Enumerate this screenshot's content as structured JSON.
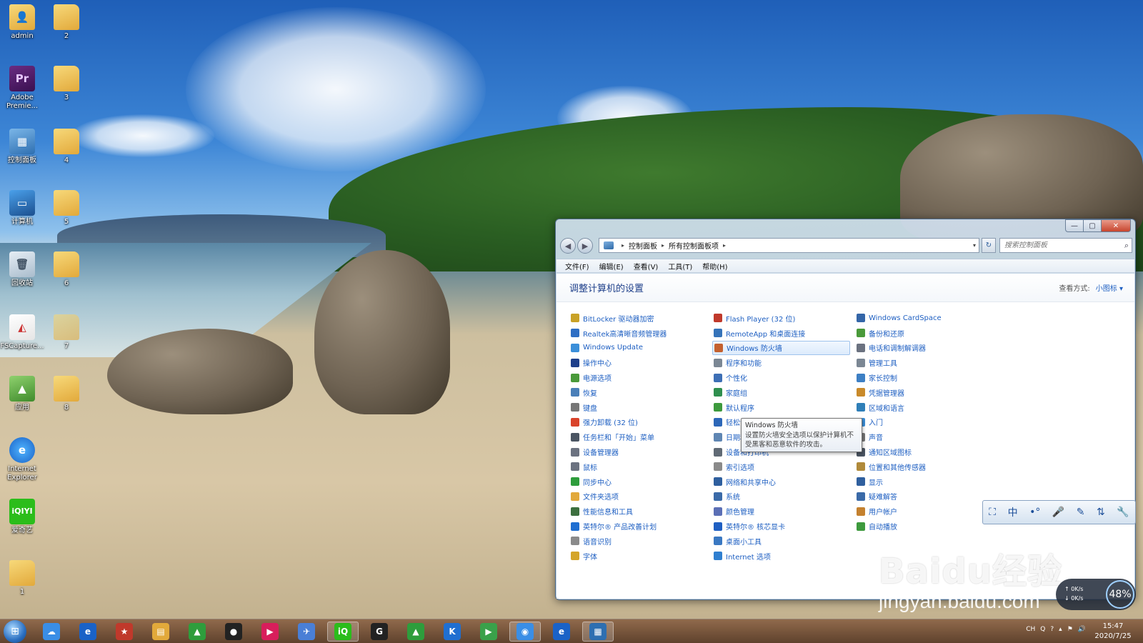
{
  "desktop": {
    "icons": [
      {
        "label": "admin",
        "glyph": "👤"
      },
      {
        "label": "2",
        "glyph": ""
      },
      {
        "label": "Adobe Premie...",
        "glyph": "Pr"
      },
      {
        "label": "3",
        "glyph": ""
      },
      {
        "label": "控制面板",
        "glyph": "▦"
      },
      {
        "label": "4",
        "glyph": ""
      },
      {
        "label": "计算机",
        "glyph": "▭"
      },
      {
        "label": "5",
        "glyph": ""
      },
      {
        "label": "回收站",
        "glyph": "🗑"
      },
      {
        "label": "6",
        "glyph": ""
      },
      {
        "label": "FSCapture...",
        "glyph": "◭"
      },
      {
        "label": "7",
        "glyph": ""
      },
      {
        "label": "应用",
        "glyph": "▲"
      },
      {
        "label": "8",
        "glyph": ""
      },
      {
        "label": "Internet Explorer",
        "glyph": "e"
      },
      {
        "label": "爱奇艺",
        "glyph": "iQIYI"
      },
      {
        "label": "1",
        "glyph": ""
      }
    ]
  },
  "window": {
    "controls": {
      "minimize": "—",
      "maximize": "▢",
      "close": "✕"
    },
    "nav": {
      "back": "◀",
      "forward": "▶"
    },
    "address": {
      "crumbs": [
        "控制面板",
        "所有控制面板项"
      ],
      "separator": "▸",
      "dropdown": "▾"
    },
    "refresh": "↻",
    "search": {
      "placeholder": "搜索控制面板",
      "icon": "⌕"
    },
    "menu": [
      "文件(F)",
      "编辑(E)",
      "查看(V)",
      "工具(T)",
      "帮助(H)"
    ],
    "title": "调整计算机的设置",
    "view_by_label": "查看方式:",
    "view_by_value": "小图标 ▾",
    "items": [
      {
        "label": "BitLocker 驱动器加密",
        "color": "#c9a227"
      },
      {
        "label": "Realtek高清晰音频管理器",
        "color": "#2f6fc4"
      },
      {
        "label": "Windows Update",
        "color": "#3b8fd9"
      },
      {
        "label": "操作中心",
        "color": "#1e3f8a"
      },
      {
        "label": "电源选项",
        "color": "#4a9a3a"
      },
      {
        "label": "恢复",
        "color": "#4a7fb8"
      },
      {
        "label": "键盘",
        "color": "#777777"
      },
      {
        "label": "强力卸载 (32 位)",
        "color": "#d9432a"
      },
      {
        "label": "任务栏和「开始」菜单",
        "color": "#4b5563"
      },
      {
        "label": "设备管理器",
        "color": "#6b7280"
      },
      {
        "label": "鼠标",
        "color": "#6b7280"
      },
      {
        "label": "同步中心",
        "color": "#2e9d3c"
      },
      {
        "label": "文件夹选项",
        "color": "#e2a93b"
      },
      {
        "label": "性能信息和工具",
        "color": "#3c6f3f"
      },
      {
        "label": "英特尔® 产品改善计划",
        "color": "#1f6fd1"
      },
      {
        "label": "语音识别",
        "color": "#8a8a8a"
      },
      {
        "label": "字体",
        "color": "#d4a52a"
      },
      {
        "label": "Flash Player (32 位)",
        "color": "#c0392b"
      },
      {
        "label": "RemoteApp 和桌面连接",
        "color": "#3573b9"
      },
      {
        "label": "Windows 防火墙",
        "color": "#c4612f"
      },
      {
        "label": "程序和功能",
        "color": "#7b8794"
      },
      {
        "label": "个性化",
        "color": "#3d6fb5"
      },
      {
        "label": "家庭组",
        "color": "#2f8f4e"
      },
      {
        "label": "默认程序",
        "color": "#3d9a3d"
      },
      {
        "label": "轻松访问中心",
        "color": "#2c67b8"
      },
      {
        "label": "日期和时间",
        "color": "#5f86b3"
      },
      {
        "label": "设备和打印机",
        "color": "#606a75"
      },
      {
        "label": "索引选项",
        "color": "#8a8a8a"
      },
      {
        "label": "网络和共享中心",
        "color": "#2f5f9e"
      },
      {
        "label": "系统",
        "color": "#3a6aa8"
      },
      {
        "label": "颜色管理",
        "color": "#5b6fb5"
      },
      {
        "label": "英特尔® 核芯显卡",
        "color": "#1f5fc2"
      },
      {
        "label": "桌面小工具",
        "color": "#3a78c2"
      },
      {
        "label": "Internet 选项",
        "color": "#2f7fd0"
      },
      {
        "label": "Windows CardSpace",
        "color": "#3466a8"
      },
      {
        "label": "备份和还原",
        "color": "#4a9a3a"
      },
      {
        "label": "电话和调制解调器",
        "color": "#6b7280"
      },
      {
        "label": "管理工具",
        "color": "#7b8794"
      },
      {
        "label": "家长控制",
        "color": "#3d7fc4"
      },
      {
        "label": "凭据管理器",
        "color": "#c98a2a"
      },
      {
        "label": "区域和语言",
        "color": "#2f7fb8"
      },
      {
        "label": "入门",
        "color": "#3b8fd9"
      },
      {
        "label": "声音",
        "color": "#777777"
      },
      {
        "label": "通知区域图标",
        "color": "#4b5563"
      },
      {
        "label": "位置和其他传感器",
        "color": "#b08a3a"
      },
      {
        "label": "显示",
        "color": "#2f5f9e"
      },
      {
        "label": "疑难解答",
        "color": "#3a6aa8"
      },
      {
        "label": "用户帐户",
        "color": "#c4812f"
      },
      {
        "label": "自动播放",
        "color": "#3d9a3d"
      }
    ],
    "hovered_index": 19,
    "tooltip": {
      "title": "Windows 防火墙",
      "text": "设置防火墙安全选项以保护计算机不受黑客和恶意软件的攻击。"
    }
  },
  "ime_toolbar": [
    "⛶",
    "中",
    "•°",
    "🎤",
    "✎",
    "⇅",
    "🔧"
  ],
  "watermark": {
    "brand": "Baidu经验",
    "url": "jingyan.baidu.com"
  },
  "net_widget": {
    "up": "↑ 0K/s",
    "down": "↓ 0K/s",
    "percent": "48%"
  },
  "taskbar": {
    "start_glyph": "⊞",
    "apps": [
      {
        "name": "baidu-netdisk",
        "glyph": "☁",
        "color": "#3a8ee6"
      },
      {
        "name": "ie",
        "glyph": "e",
        "color": "#1a62c7"
      },
      {
        "name": "app-red",
        "glyph": "★",
        "color": "#c0392b"
      },
      {
        "name": "explorer",
        "glyph": "▤",
        "color": "#e2a93b"
      },
      {
        "name": "app-green",
        "glyph": "▲",
        "color": "#2e9d3c"
      },
      {
        "name": "qq",
        "glyph": "●",
        "color": "#222222"
      },
      {
        "name": "youku",
        "glyph": "▶",
        "color": "#d81e5b"
      },
      {
        "name": "feishu",
        "glyph": "✈",
        "color": "#4a7fd6"
      },
      {
        "name": "iqiyi",
        "glyph": "iQ",
        "color": "#2bbd1b"
      },
      {
        "name": "app-g",
        "glyph": "G",
        "color": "#222222"
      },
      {
        "name": "app-green2",
        "glyph": "▲",
        "color": "#2e9d3c"
      },
      {
        "name": "kugou",
        "glyph": "K",
        "color": "#1f6fd1"
      },
      {
        "name": "player",
        "glyph": "▶",
        "color": "#3aa14a"
      },
      {
        "name": "browser",
        "glyph": "◉",
        "color": "#3a8ee6"
      },
      {
        "name": "ie2",
        "glyph": "e",
        "color": "#1a62c7"
      },
      {
        "name": "control-panel",
        "glyph": "▦",
        "color": "#2e6fb1"
      }
    ],
    "tray": [
      "CH",
      "Q",
      "?",
      "▴",
      "⚑",
      "🔊"
    ],
    "time": "15:47",
    "date": "2020/7/25"
  }
}
